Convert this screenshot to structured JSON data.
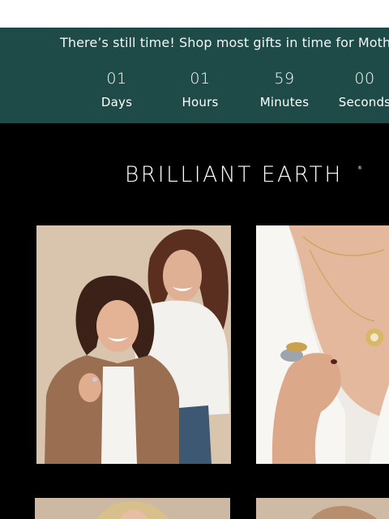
{
  "promo": {
    "message": "There’s still time! Shop most gifts in time for Mother’s",
    "background_color": "#1e4a47",
    "countdown": [
      {
        "value": "01",
        "label": "Days"
      },
      {
        "value": "01",
        "label": "Hours"
      },
      {
        "value": "59",
        "label": "Minutes"
      },
      {
        "value": "00",
        "label": "Seconds"
      }
    ]
  },
  "brand": {
    "logo_text": "BRILLIANT EARTH",
    "registered_mark": "®"
  },
  "gallery": {
    "background_color": "#000000",
    "images": [
      {
        "name": "mother-daughter-photo"
      },
      {
        "name": "necklace-ring-closeup-photo"
      },
      {
        "name": "model-photo-row-2-left"
      },
      {
        "name": "model-photo-row-2-right"
      }
    ]
  }
}
